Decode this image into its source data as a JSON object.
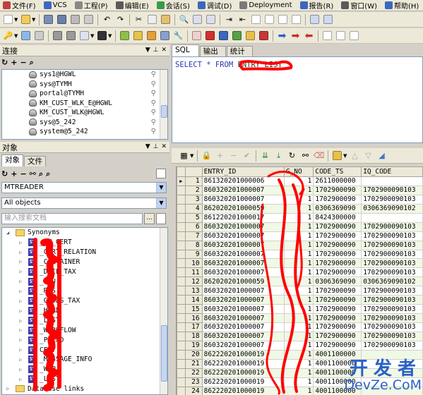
{
  "menu": [
    "文件(F)",
    "VCS",
    "工程(P)",
    "编辑(E)",
    "会话(S)",
    "调试(D)",
    "Deployment",
    "报告(R)",
    "窗口(W)",
    "帮助(H)"
  ],
  "connection_panel": {
    "title": "连接",
    "items": [
      "sys1@HGWL",
      "sys@TYMH",
      "portal@TYMH",
      "KM_CUST_WLK_E@HGWL",
      "KM_CUST_WLK@HGWL",
      "sys@5_242",
      "system@5_242"
    ]
  },
  "object_panel": {
    "title": "对象",
    "tabs": [
      "对象",
      "文件"
    ],
    "owner": "MTREADER",
    "filter": "All objects",
    "search_placeholder": "输入搜索文档",
    "tree_root": "Synonyms",
    "tree_items": [
      "_RY_CERT",
      "_CERT_RELATION",
      "_CONTAINER",
      "_DECL_TAX",
      "_OCU",
      "_RES",
      "_GOODS_TAX",
      "_HEAD",
      "_LIST",
      "_WORKFLOW",
      "_PPEND",
      "CERT",
      "_MESSAGE_INFO",
      "_WAP",
      "_LIST"
    ],
    "tree_footer": "Database links"
  },
  "editor": {
    "tabs": [
      "SQL",
      "输出",
      "统计"
    ],
    "sql_keyword": "SELECT * FROM",
    "sql_table": "ENTRY_LIST"
  },
  "grid": {
    "columns": [
      "ENTRY_ID",
      "G_NO",
      "CODE_TS",
      "IQ_CODE"
    ],
    "rows": [
      [
        "861320201000006",
        "1",
        "2611000000",
        ""
      ],
      [
        "860320201000007",
        "1",
        "1702900090",
        "1702900090103"
      ],
      [
        "860320201000007",
        "1",
        "1702900090",
        "1702900090103"
      ],
      [
        "862020201000059",
        "1",
        "0306369090",
        "0306369090102"
      ],
      [
        "861220201000017",
        "1",
        "8424300000",
        ""
      ],
      [
        "860320201000007",
        "1",
        "1702900090",
        "1702900090103"
      ],
      [
        "860320201000007",
        "1",
        "1702900090",
        "1702900090103"
      ],
      [
        "860320201000007",
        "1",
        "1702900090",
        "1702900090103"
      ],
      [
        "860320201000007",
        "1",
        "1702900090",
        "1702900090103"
      ],
      [
        "860320201000007",
        "1",
        "1702900090",
        "1702900090103"
      ],
      [
        "860320201000007",
        "1",
        "1702900090",
        "1702900090103"
      ],
      [
        "862020201000059",
        "1",
        "0306369090",
        "0306369090102"
      ],
      [
        "860320201000007",
        "1",
        "1702900090",
        "1702900090103"
      ],
      [
        "860320201000007",
        "1",
        "1702900090",
        "1702900090103"
      ],
      [
        "860320201000007",
        "1",
        "1702900090",
        "1702900090103"
      ],
      [
        "860320201000007",
        "1",
        "1702900090",
        "1702900090103"
      ],
      [
        "860320201000007",
        "1",
        "1702900090",
        "1702900090103"
      ],
      [
        "860320201000007",
        "1",
        "1702900090",
        "1702900090103"
      ],
      [
        "860320201000007",
        "1",
        "1702900090",
        "1702900090103"
      ],
      [
        "862220201000019",
        "1",
        "4001100000",
        ""
      ],
      [
        "862220201000019",
        "1",
        "4001100000",
        ""
      ],
      [
        "862220201000019",
        "1",
        "4001100000",
        ""
      ],
      [
        "862220201000019",
        "1",
        "4001100000",
        ""
      ],
      [
        "862220201000019",
        "1",
        "4001100000",
        ""
      ]
    ]
  },
  "watermark": {
    "line1": "开发者",
    "line2": "DevZe.CoM"
  },
  "colors": {
    "accent": "#2a61c8",
    "redact": "#ff0000",
    "sql_keyword": "#2a36b0"
  }
}
